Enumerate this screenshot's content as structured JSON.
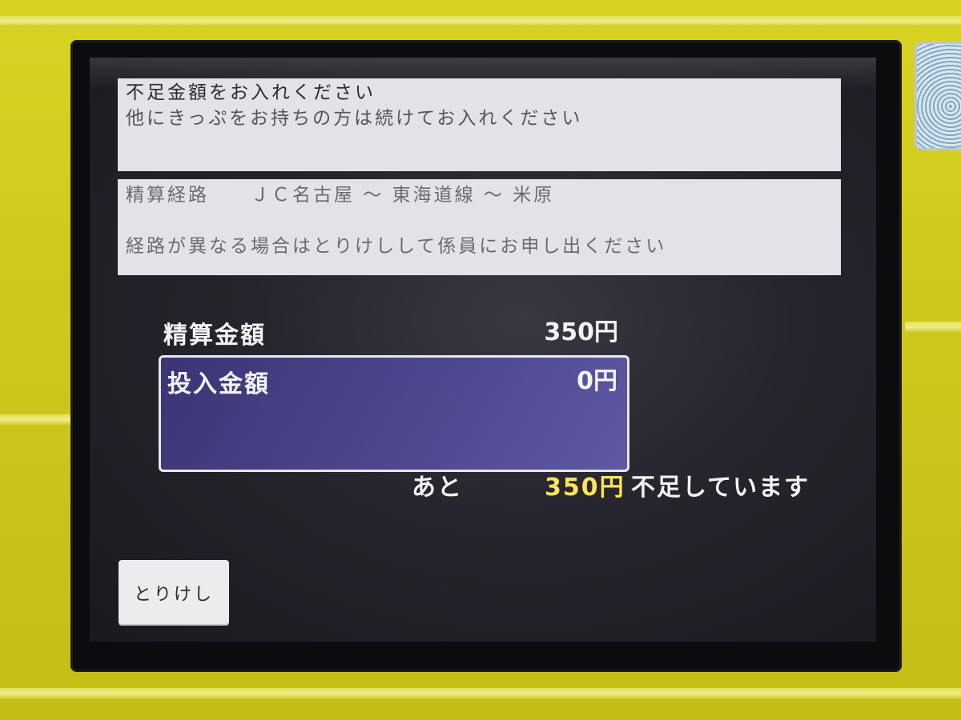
{
  "messages": {
    "line1": "不足金額をお入れください",
    "line2": "他にきっぷをお持ちの方は続けてお入れください"
  },
  "route": {
    "label": "精算経路",
    "path": "ＪＣ名古屋 〜 東海道線 〜 米原",
    "notice": "経路が異なる場合はとりけしして係員にお申し出ください"
  },
  "fare": {
    "label": "精算金額",
    "amount": "350円"
  },
  "inserted": {
    "label": "投入金額",
    "amount": "0円"
  },
  "shortfall": {
    "prefix": "あと",
    "amount": "350円",
    "suffix": "不足しています"
  },
  "buttons": {
    "cancel": "とりけし"
  },
  "colors": {
    "machine_body": "#cfc81c",
    "screen_bg": "#26242c",
    "insert_box": "#4d4790",
    "shortfall_highlight": "#ffe45a"
  }
}
